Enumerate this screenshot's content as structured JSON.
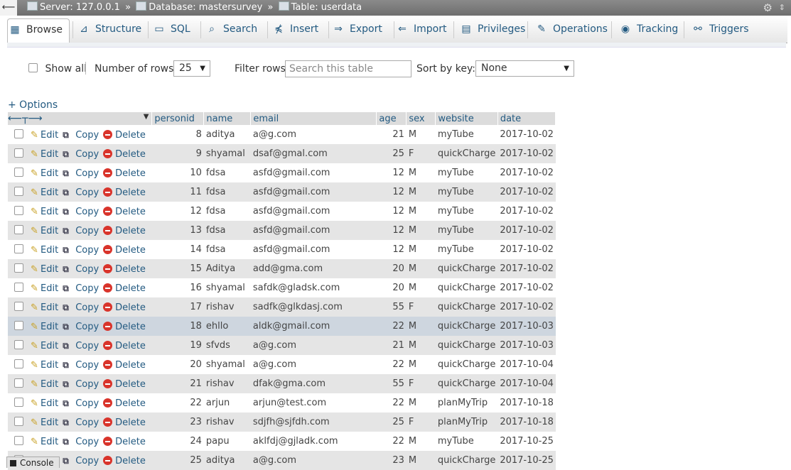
{
  "breadcrumb": {
    "server_label": "Server: 127.0.0.1",
    "database_label": "Database: mastersurvey",
    "table_label": "Table: userdata",
    "separator": "»"
  },
  "tabs": [
    {
      "label": "Browse",
      "icon": "browse-icon",
      "active": true
    },
    {
      "label": "Structure",
      "icon": "structure-icon"
    },
    {
      "label": "SQL",
      "icon": "sql-icon"
    },
    {
      "label": "Search",
      "icon": "search-icon"
    },
    {
      "label": "Insert",
      "icon": "insert-icon"
    },
    {
      "label": "Export",
      "icon": "export-icon"
    },
    {
      "label": "Import",
      "icon": "import-icon"
    },
    {
      "label": "Privileges",
      "icon": "privileges-icon"
    },
    {
      "label": "Operations",
      "icon": "operations-icon"
    },
    {
      "label": "Tracking",
      "icon": "tracking-icon"
    },
    {
      "label": "Triggers",
      "icon": "triggers-icon"
    }
  ],
  "nav": {
    "show_all_label": "Show all",
    "rows_label": "Number of rows:",
    "rows_value": "25",
    "filter_label": "Filter rows:",
    "filter_placeholder": "Search this table",
    "sort_label": "Sort by key:",
    "sort_value": "None"
  },
  "options_link": "+ Options",
  "table": {
    "columns": [
      "personid",
      "name",
      "email",
      "age",
      "sex",
      "website",
      "date"
    ],
    "actions": {
      "edit": "Edit",
      "copy": "Copy",
      "delete": "Delete"
    },
    "rows": [
      [
        "8",
        "aditya",
        "a@g.com",
        "21",
        "M",
        "myTube",
        "2017-10-02"
      ],
      [
        "9",
        "shyamal",
        "dsaf@gmal.com",
        "25",
        "F",
        "quickCharge",
        "2017-10-02"
      ],
      [
        "10",
        "fdsa",
        "asfd@gmail.com",
        "12",
        "M",
        "myTube",
        "2017-10-02"
      ],
      [
        "11",
        "fdsa",
        "asfd@gmail.com",
        "12",
        "M",
        "myTube",
        "2017-10-02"
      ],
      [
        "12",
        "fdsa",
        "asfd@gmail.com",
        "12",
        "M",
        "myTube",
        "2017-10-02"
      ],
      [
        "13",
        "fdsa",
        "asfd@gmail.com",
        "12",
        "M",
        "myTube",
        "2017-10-02"
      ],
      [
        "14",
        "fdsa",
        "asfd@gmail.com",
        "12",
        "M",
        "myTube",
        "2017-10-02"
      ],
      [
        "15",
        "Aditya",
        "add@gma.com",
        "20",
        "M",
        "quickCharge",
        "2017-10-02"
      ],
      [
        "16",
        "shyamal",
        "safdk@gladsk.com",
        "20",
        "M",
        "quickCharge",
        "2017-10-02"
      ],
      [
        "17",
        "rishav",
        "sadfk@glkdasj.com",
        "55",
        "F",
        "quickCharge",
        "2017-10-02"
      ],
      [
        "18",
        "ehllo",
        "aldk@gmail.com",
        "22",
        "M",
        "quickCharge",
        "2017-10-03"
      ],
      [
        "19",
        "sfvds",
        "a@g.com",
        "21",
        "M",
        "quickCharge",
        "2017-10-03"
      ],
      [
        "20",
        "shyamal",
        "a@g.com",
        "22",
        "M",
        "quickCharge",
        "2017-10-04"
      ],
      [
        "21",
        "rishav",
        "dfak@gma.com",
        "55",
        "F",
        "quickCharge",
        "2017-10-04"
      ],
      [
        "22",
        "arjun",
        "arjun@test.com",
        "22",
        "M",
        "planMyTrip",
        "2017-10-18"
      ],
      [
        "23",
        "rishav",
        "sdjfh@sjfdh.com",
        "25",
        "F",
        "planMyTrip",
        "2017-10-18"
      ],
      [
        "24",
        "papu",
        "aklfdj@gjladk.com",
        "22",
        "M",
        "myTube",
        "2017-10-25"
      ],
      [
        "25",
        "aditya",
        "a@g.com",
        "23",
        "M",
        "quickCharge",
        "2017-10-25"
      ]
    ],
    "highlighted_row": 10
  },
  "console_label": "Console",
  "colors": {
    "link": "#235a81",
    "highlight_row": "#ced6df",
    "even_row": "#e5e5e5",
    "delete_icon": "#d9342b"
  }
}
